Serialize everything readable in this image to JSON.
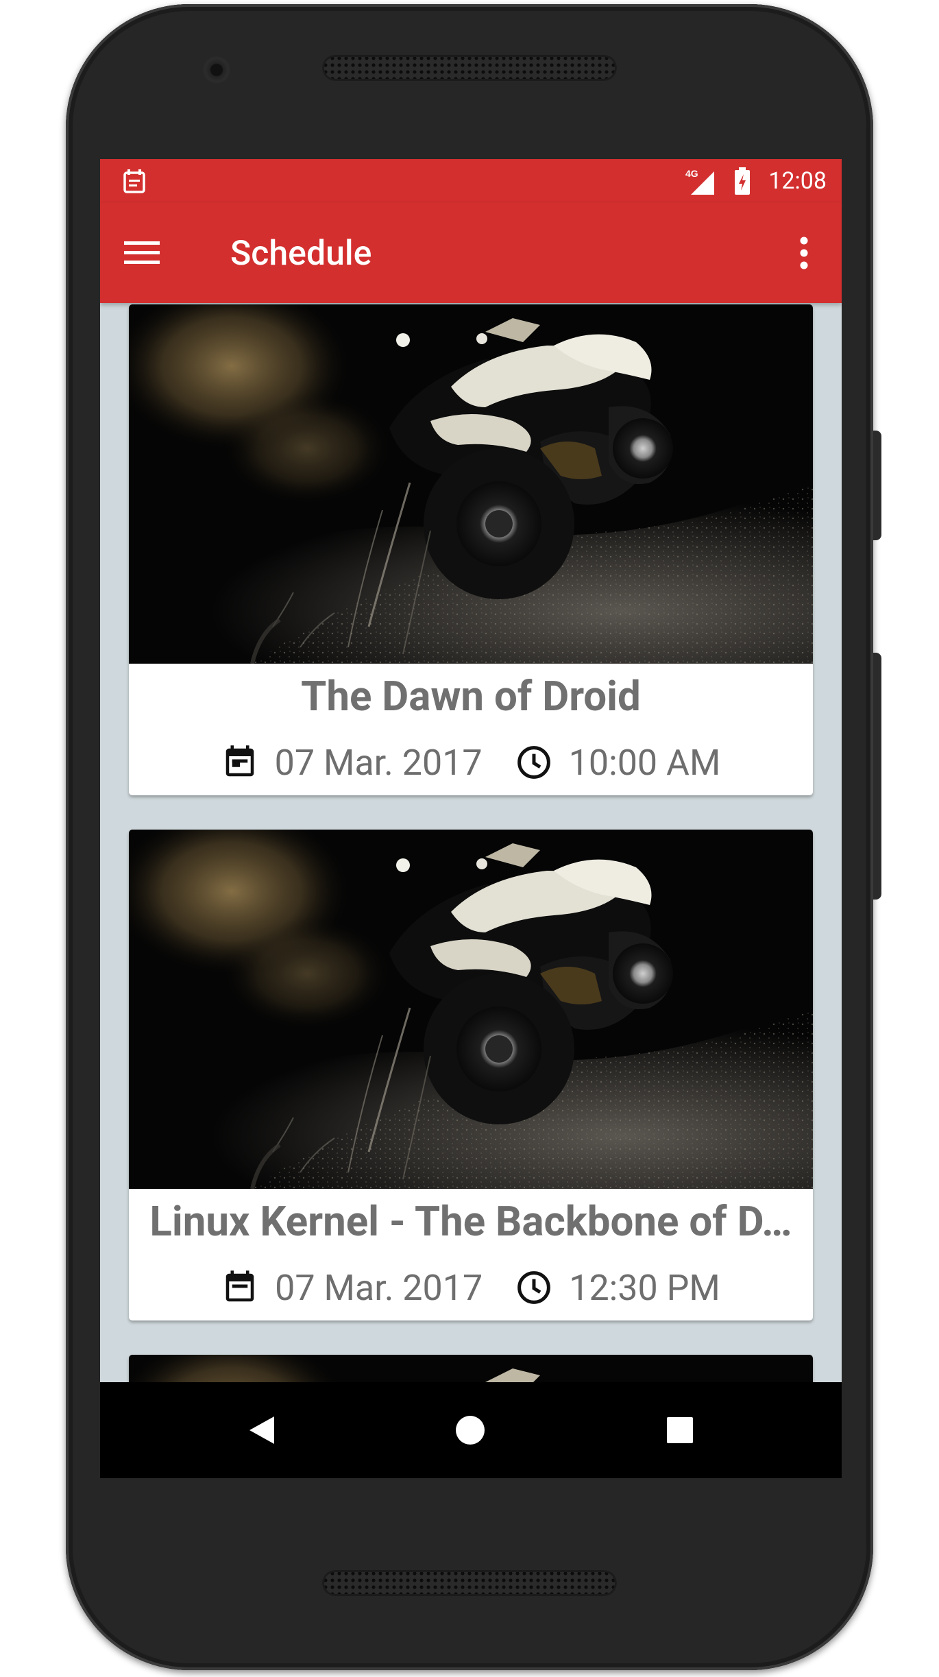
{
  "status_bar": {
    "network_label": "4G",
    "time": "12:08",
    "icons": [
      "calendar-notification-icon",
      "signal-4g-icon",
      "battery-charging-icon"
    ]
  },
  "app_bar": {
    "title": "Schedule",
    "menu_icon": "hamburger-menu-icon",
    "overflow_icon": "more-vert-icon"
  },
  "sessions": [
    {
      "title": "The Dawn of Droid",
      "date": "07 Mar. 2017",
      "time": "10:00 AM",
      "image": "atv-dirt-bike-photo"
    },
    {
      "title": "Linux Kernel - The Backbone of D…",
      "date": "07 Mar. 2017",
      "time": "12:30 PM",
      "image": "atv-dirt-bike-photo"
    },
    {
      "title": "",
      "date": "",
      "time": "",
      "image": "atv-dirt-bike-photo"
    }
  ],
  "nav_bar": {
    "buttons": [
      "back-icon",
      "home-icon",
      "recents-icon"
    ]
  },
  "colors": {
    "primary": "#d32f2f",
    "background": "#cfd8dc",
    "card": "#ffffff",
    "card_text": "#707070"
  }
}
